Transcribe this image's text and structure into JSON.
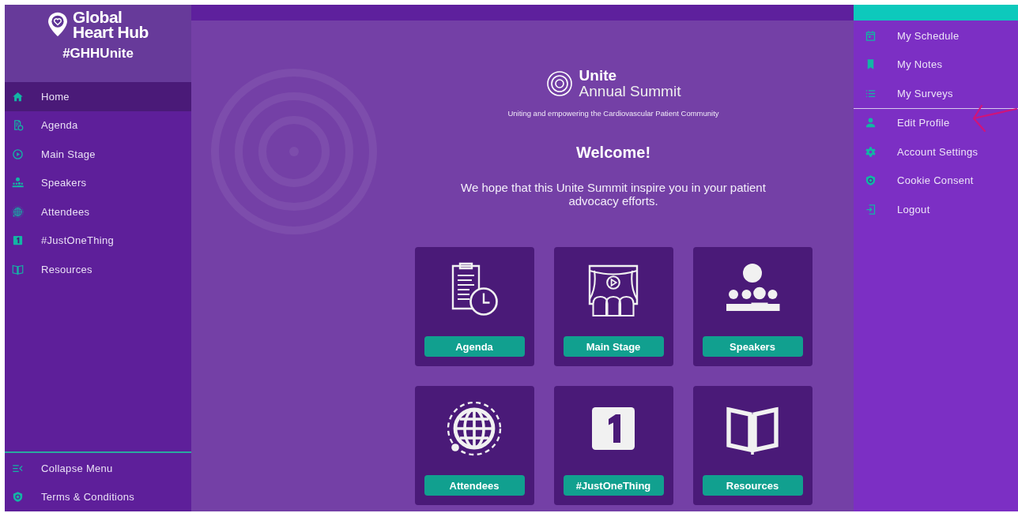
{
  "sidebar": {
    "brand": {
      "line_1": "Global",
      "line_2": "Heart Hub"
    },
    "hashtag": "#GHHUnite",
    "items": [
      {
        "label": "Home",
        "selected": true
      },
      {
        "label": "Agenda",
        "selected": false
      },
      {
        "label": "Main Stage",
        "selected": false
      },
      {
        "label": "Speakers",
        "selected": false
      },
      {
        "label": "Attendees",
        "selected": false
      },
      {
        "label": "#JustOneThing",
        "selected": false
      },
      {
        "label": "Resources",
        "selected": false
      }
    ],
    "footer_items": [
      {
        "label": "Collapse Menu"
      },
      {
        "label": "Terms & Conditions"
      }
    ]
  },
  "main": {
    "logo": {
      "line_1": "Unite",
      "line_2": "Annual Summit"
    },
    "tagline": "Uniting and empowering the Cardiovascular Patient Community",
    "heading": "Welcome!",
    "message": "We hope that this Unite Summit inspire you in your patient advocacy efforts.",
    "tiles": [
      {
        "label": "Agenda"
      },
      {
        "label": "Main Stage"
      },
      {
        "label": "Speakers"
      },
      {
        "label": "Attendees"
      },
      {
        "label": "#JustOneThing"
      },
      {
        "label": "Resources"
      }
    ]
  },
  "user_menu": {
    "groups": [
      [
        {
          "label": "My Schedule"
        },
        {
          "label": "My Notes"
        },
        {
          "label": "My Surveys"
        }
      ],
      [
        {
          "label": "Edit Profile"
        },
        {
          "label": "Account Settings"
        },
        {
          "label": "Cookie Consent"
        },
        {
          "label": "Logout"
        }
      ]
    ]
  }
}
